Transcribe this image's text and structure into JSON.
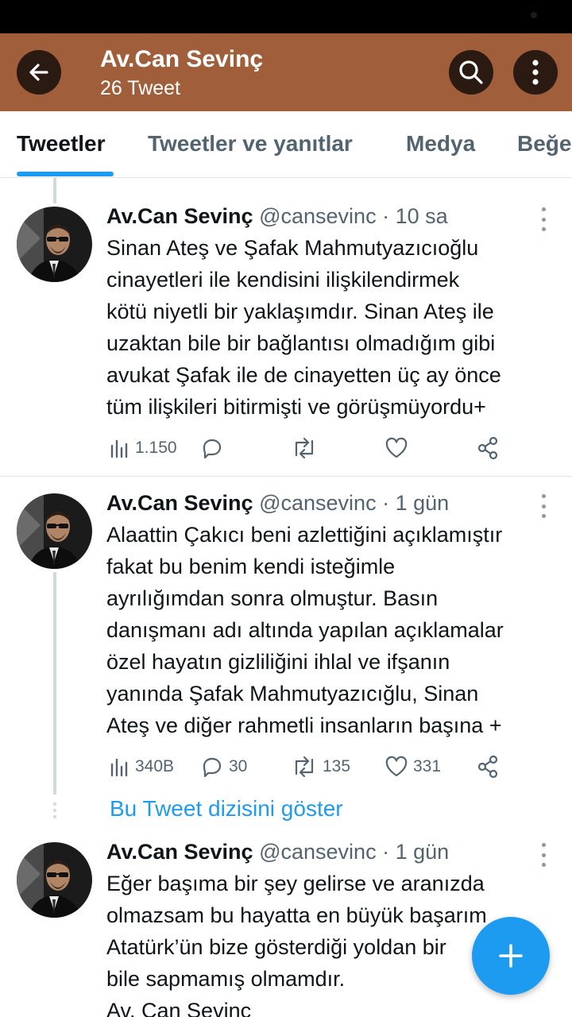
{
  "header": {
    "title": "Av.Can Sevinç",
    "subtitle": "26 Tweet",
    "back_icon": "arrow-left-icon",
    "search_icon": "search-icon",
    "more_icon": "more-vertical-icon",
    "color": "#a05f3a"
  },
  "tabs": [
    "Tweetler",
    "Tweetler ve yanıtlar",
    "Medya",
    "Beğe"
  ],
  "active_tab": "Tweetler",
  "tweets": [
    {
      "name": "Av.Can Sevinç",
      "handle": "@cansevinc",
      "time": "10 sa",
      "lines": [
        "Sinan Ateş ve Şafak Mahmutyazıcıoğlu",
        "cinayetleri ile kendisini ilişkilendirmek",
        "kötü niyetli bir yaklaşımdır. Sinan Ateş ile",
        "uzaktan bile bir bağlantısı olmadığım gibi",
        "avukat Şafak ile de cinayetten üç ay önce",
        "tüm ilişkileri bitirmişti ve görüşmüyordu+"
      ],
      "views": "1.150",
      "replies": "",
      "retweets": "",
      "likes": ""
    },
    {
      "name": "Av.Can Sevinç",
      "handle": "@cansevinc",
      "time": "1 gün",
      "lines": [
        "Alaattin Çakıcı beni azlettiğini açıklamıştır",
        "fakat bu benim kendi isteğimle",
        "ayrılığımdan sonra olmuştur. Basın",
        "danışmanı adı altında yapılan açıklamalar",
        "özel hayatın gizliliğini ihlal ve ifşanın",
        "yanında Şafak Mahmutyazıcığlu, Sinan",
        "Ateş ve diğer rahmetli insanların başına +"
      ],
      "views": "340B",
      "replies": "30",
      "retweets": "135",
      "likes": "331"
    },
    {
      "name": "Av.Can Sevinç",
      "handle": "@cansevinc",
      "time": "1 gün",
      "lines": [
        "Eğer başıma bir şey gelirse ve aranızda",
        "olmazsam bu hayatta en büyük başarım",
        "Atatürk’ün bize gösterdiği yoldan bir",
        "bile sapmamış olmamdır.",
        "Av. Can Sevinç"
      ]
    }
  ],
  "show_thread": "Bu Tweet dizisini göster",
  "fab_icon": "plus-icon",
  "accent": "#1d9bf0"
}
